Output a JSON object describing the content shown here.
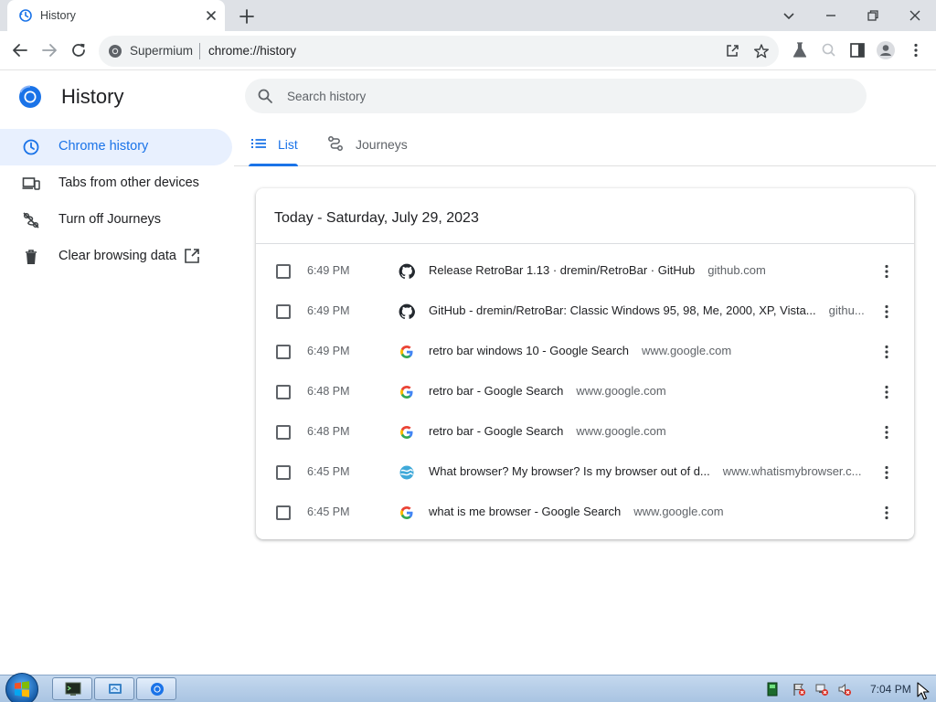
{
  "browser": {
    "tab_title": "History",
    "site_label": "Supermium",
    "url": "chrome://history"
  },
  "page": {
    "title": "History",
    "search_placeholder": "Search history"
  },
  "sidebar": {
    "items": [
      {
        "label": "Chrome history",
        "icon": "clock-icon",
        "active": true
      },
      {
        "label": "Tabs from other devices",
        "icon": "devices-icon"
      },
      {
        "label": "Turn off Journeys",
        "icon": "journeys-off-icon"
      },
      {
        "label": "Clear browsing data",
        "icon": "trash-icon",
        "external": "external-link-icon"
      }
    ]
  },
  "view_tabs": [
    {
      "label": "List",
      "icon": "list-icon",
      "active": true
    },
    {
      "label": "Journeys",
      "icon": "journeys-icon"
    }
  ],
  "history": {
    "date_heading": "Today - Saturday, July 29, 2023",
    "entries": [
      {
        "time": "6:49 PM",
        "title": "Release RetroBar 1.13 · dremin/RetroBar · GitHub",
        "domain": "github.com",
        "favicon": "github-icon"
      },
      {
        "time": "6:49 PM",
        "title": "GitHub - dremin/RetroBar: Classic Windows 95, 98, Me, 2000, XP, Vista...",
        "domain": "githu...",
        "favicon": "github-icon"
      },
      {
        "time": "6:49 PM",
        "title": "retro bar windows 10 - Google Search",
        "domain": "www.google.com",
        "favicon": "google-icon"
      },
      {
        "time": "6:48 PM",
        "title": "retro bar - Google Search",
        "domain": "www.google.com",
        "favicon": "google-icon"
      },
      {
        "time": "6:48 PM",
        "title": "retro bar - Google Search",
        "domain": "www.google.com",
        "favicon": "google-icon"
      },
      {
        "time": "6:45 PM",
        "title": "What browser? My browser? Is my browser out of d...",
        "domain": "www.whatismybrowser.c...",
        "favicon": "whatismybrowser-icon"
      },
      {
        "time": "6:45 PM",
        "title": "what is me browser - Google Search",
        "domain": "www.google.com",
        "favicon": "google-icon"
      }
    ]
  },
  "taskbar": {
    "clock": "7:04 PM"
  },
  "colors": {
    "accent": "#1a73e8",
    "active_bg": "#e8f0fe",
    "tabstrip_bg": "#dee1e6",
    "omnibox_bg": "#f1f3f4"
  }
}
